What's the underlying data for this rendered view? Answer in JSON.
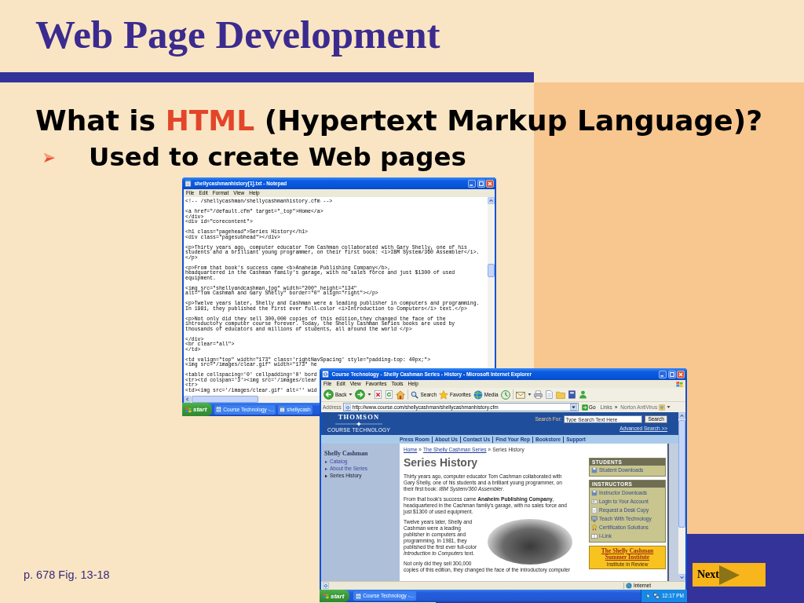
{
  "slide": {
    "title": "Web Page Development",
    "heading": {
      "before": "What is ",
      "term": "HTML",
      "after": " (Hypertext Markup Language)?"
    },
    "bullets": [
      "Used to create Web pages"
    ],
    "caption": "p. 678 Fig. 13-18",
    "next_button": "Next"
  },
  "notepad_window": {
    "title": "shellycashmanhistory[1].txt - Notepad",
    "menu": [
      "File",
      "Edit",
      "Format",
      "View",
      "Help"
    ],
    "blocks": [
      [
        "<!-- /shellycashman/shellycashmanhistory.cfm -->"
      ],
      [
        "<a href=\"/default.cfm\" target=\"_top\">Home</a>",
        "</div>",
        "<div id=\"corecontent\">"
      ],
      [
        "<h1 class=\"pagehead\">Series History</h1>",
        "<div class=\"pagesubhead\"></div>"
      ],
      [
        "<p>Thirty years ago, computer educator Tom Cashman collaborated with Gary Shelly, one of his",
        "students and a brilliant young programmer, on their first book: <i>IBM System/360 Assembler</i>.",
        "</p>"
      ],
      [
        "<p>From that book's success came <b>Anaheim Publishing Company</b>,",
        "headquartered in the Cashman family's garage, with no sales force and just $1300 of used",
        "equipment."
      ],
      [
        "<img src=\"shellyandcashman.jpg\" width=\"200\" height=\"134\"",
        "alt=\"Tom Cashman and Gary Shelly\" border=\"0\" align=\"right\"></p>"
      ],
      [
        "<p>Twelve years later, Shelly and Cashman were a leading publisher in computers and programming.",
        "In 1981, they published the first ever full-color <i>Introduction to Computers</i> text.</p>"
      ],
      [
        "<p>Not only did they sell 300,000 copies of this edition,they changed the face of the",
        "introductory computer course forever. Today, the Shelly Cashman Series books are used by",
        "thousands of educators and millions of students, all around the world </p>"
      ],
      [
        "</div>",
        "<br clear=\"all\">",
        "</td>"
      ],
      [
        "<td valign=\"top\" width=\"173\" class='rightNavSpacing' style=\"padding-top: 40px;\">",
        "<img src=\"/images/clear.gif\" width=\"173\" he"
      ],
      [
        "<table cellspacing='0' cellpadding='0' bord",
        "<tr><td colspan='3'><img src='/images/clear",
        "<tr>",
        "<td><img src='/images/clear.gif' alt='' wid"
      ]
    ],
    "taskbar": {
      "start": "start",
      "tasks": [
        "Course Technology -...",
        "shellycash"
      ]
    }
  },
  "browser_window": {
    "title": "Course Technology - Shelly Cashman Series - History - Microsoft Internet Explorer",
    "menu": [
      "File",
      "Edit",
      "View",
      "Favorites",
      "Tools",
      "Help"
    ],
    "toolbar": {
      "back": "Back",
      "search": "Search",
      "favorites": "Favorites",
      "media": "Media"
    },
    "address_bar": {
      "label": "Address",
      "url": "http://www.course.com/shellycashman/shellycashmanhistory.cfm",
      "go": "Go",
      "links": "Links",
      "chevron": "»",
      "extension": "Norton AntiVirus"
    },
    "page": {
      "logo": {
        "wordmark": "THOMSON",
        "tagline": "COURSE TECHNOLOGY"
      },
      "search": {
        "label": "Search For:",
        "placeholder": "Type Search Text Here",
        "button": "Search",
        "advanced_link": "Advanced Search >>"
      },
      "nav_links": [
        "Press Room",
        "About Us",
        "Contact Us",
        "Find Your Rep",
        "Bookstore",
        "Support"
      ],
      "sidebar": {
        "heading": "Shelly Cashman",
        "items": [
          {
            "label": "Catalog",
            "selected": false
          },
          {
            "label": "About the Series",
            "selected": false
          },
          {
            "label": "Series History",
            "selected": true
          }
        ]
      },
      "breadcrumb": [
        {
          "text": "Home",
          "kind": "link"
        },
        {
          "text": "»",
          "kind": "separator"
        },
        {
          "text": "The Shelly Cashman Series",
          "kind": "link"
        },
        {
          "text": "»",
          "kind": "separator"
        },
        {
          "text": "Series History",
          "kind": "current"
        }
      ],
      "heading": "Series History",
      "paragraphs": [
        "Thirty years ago, computer educator Tom Cashman collaborated with Gary Shelly, one of his students and a brilliant young programmer, on their first book: *IBM System/360 Assembler*.",
        "From that book's success came **Anaheim Publishing Company**, headquartered in the Cashman family's garage, with no sales force and just $1300 of used equipment.",
        "Twelve years later, Shelly and Cashman were a leading publisher in computers and programming. In 1981, they published the first ever full-color *Introduction to Computers* text.",
        "Not only did they sell 300,000 copies of this edition, they changed the face of the introductory computer"
      ],
      "students_box": {
        "heading": "STUDENTS",
        "items": [
          "Student Downloads"
        ]
      },
      "instructors_box": {
        "heading": "INSTRUCTORS",
        "items": [
          "Instructor Downloads",
          "Login to Your Account",
          "Request a Desk Copy",
          "Teach With Technology",
          "Certification Solutions",
          "I-Link"
        ]
      },
      "institute_box": {
        "title": "The Shelly Cashman Summer Institute",
        "subtitle": "Institute in Review"
      }
    },
    "status_bar": {
      "zone": "Internet"
    },
    "taskbar": {
      "start": "start",
      "tasks": [
        "Course Technology -..."
      ],
      "clock": "12:17 PM"
    }
  }
}
